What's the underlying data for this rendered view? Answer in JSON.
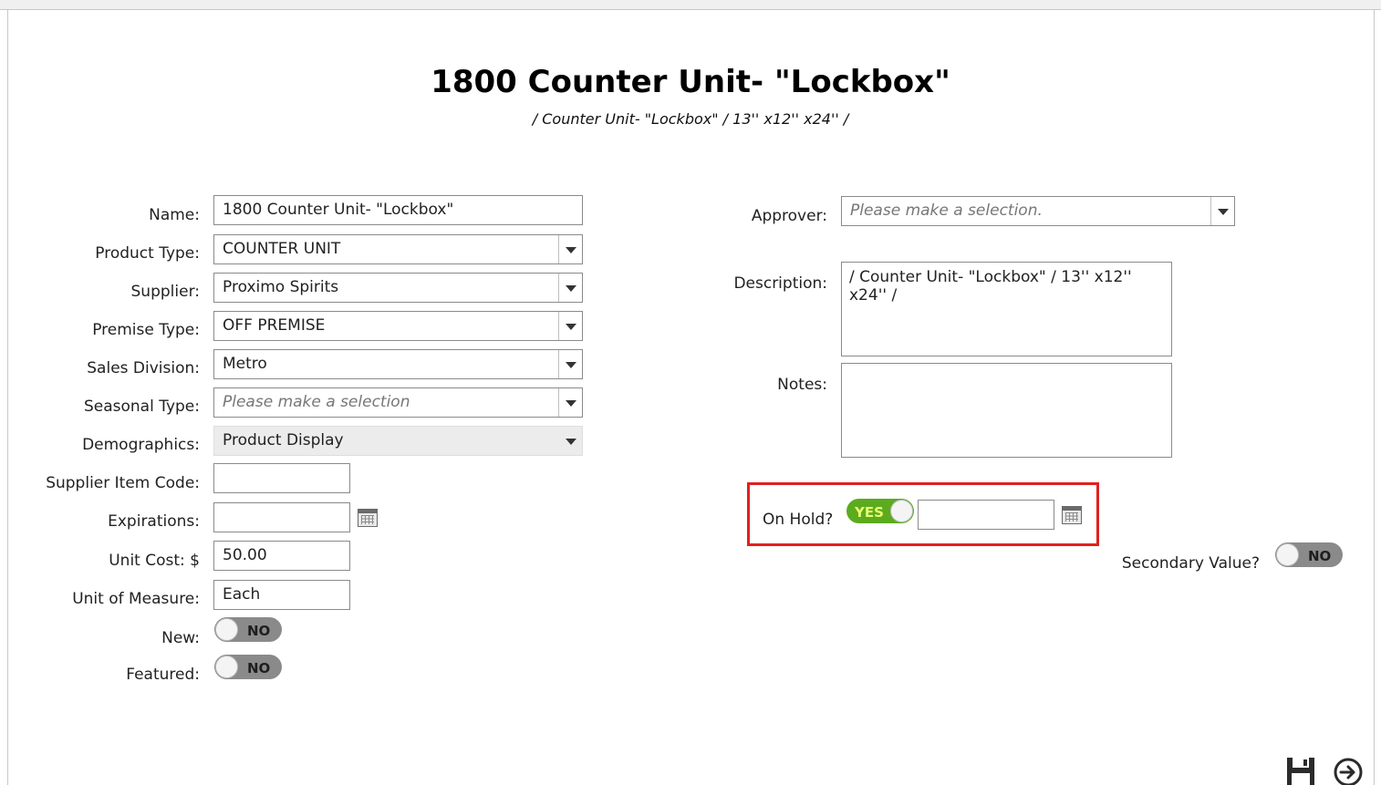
{
  "page": {
    "title": "1800 Counter Unit- \"Lockbox\"",
    "subtitle": "/ Counter Unit- \"Lockbox\" / 13'' x12'' x24'' /"
  },
  "left_form": {
    "name": {
      "label": "Name:",
      "value": "1800 Counter Unit- \"Lockbox\""
    },
    "product_type": {
      "label": "Product Type:",
      "value": "COUNTER UNIT"
    },
    "supplier": {
      "label": "Supplier:",
      "value": "Proximo Spirits"
    },
    "premise_type": {
      "label": "Premise Type:",
      "value": "OFF PREMISE"
    },
    "sales_division": {
      "label": "Sales Division:",
      "value": "Metro"
    },
    "seasonal_type": {
      "label": "Seasonal Type:",
      "placeholder": "Please make a selection"
    },
    "demographics": {
      "label": "Demographics:",
      "value": "Product Display"
    },
    "supplier_item_code": {
      "label": "Supplier Item Code:",
      "value": ""
    },
    "expirations": {
      "label": "Expirations:",
      "value": ""
    },
    "unit_cost": {
      "label": "Unit Cost: $",
      "value": "50.00"
    },
    "unit_of_measure": {
      "label": "Unit of Measure:",
      "value": "Each"
    },
    "new": {
      "label": "New:",
      "toggle": "NO"
    },
    "featured": {
      "label": "Featured:",
      "toggle": "NO"
    }
  },
  "right_form": {
    "approver": {
      "label": "Approver:",
      "placeholder": "Please make a selection."
    },
    "description": {
      "label": "Description:",
      "value": "/ Counter Unit- \"Lockbox\" / 13'' x12'' x24'' /"
    },
    "notes": {
      "label": "Notes:",
      "value": ""
    },
    "on_hold": {
      "label": "On Hold?",
      "toggle": "YES",
      "date": ""
    },
    "secondary_value": {
      "label": "Secondary Value?",
      "toggle": "NO"
    }
  },
  "icons": {
    "calendar": "calendar-icon",
    "dropdown": "chevron-down-icon",
    "save": "save-icon",
    "next": "arrow-right-circle-icon"
  },
  "colors": {
    "toggle_on": "#5cab1f",
    "toggle_off": "#8a8a8a",
    "highlight": "#e02020"
  }
}
